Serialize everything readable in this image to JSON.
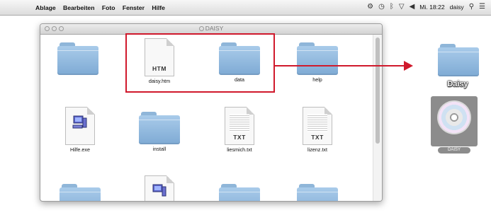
{
  "menubar": {
    "apple_glyph": "",
    "items": [
      "Ablage",
      "Bearbeiten",
      "Foto",
      "Fenster",
      "Hilfe"
    ],
    "status": {
      "clock": "Mi. 18:22",
      "user": "daisy"
    }
  },
  "window": {
    "title": "DAISY",
    "items": [
      {
        "label": "",
        "kind": "folder"
      },
      {
        "label": "daisy.htm",
        "kind": "doc",
        "ext": "HTM"
      },
      {
        "label": "data",
        "kind": "folder"
      },
      {
        "label": "help",
        "kind": "folder"
      },
      {
        "label": "Hilfe.exe",
        "kind": "exe"
      },
      {
        "label": "install",
        "kind": "folder"
      },
      {
        "label": "liesmich.txt",
        "kind": "doc",
        "ext": "TXT"
      },
      {
        "label": "lizenz.txt",
        "kind": "doc",
        "ext": "TXT"
      }
    ]
  },
  "desktop": {
    "folder_label": "Daisy",
    "disk_label": "DAISY"
  },
  "colors": {
    "highlight": "#d0192c",
    "folder": "#8fb6d9"
  }
}
